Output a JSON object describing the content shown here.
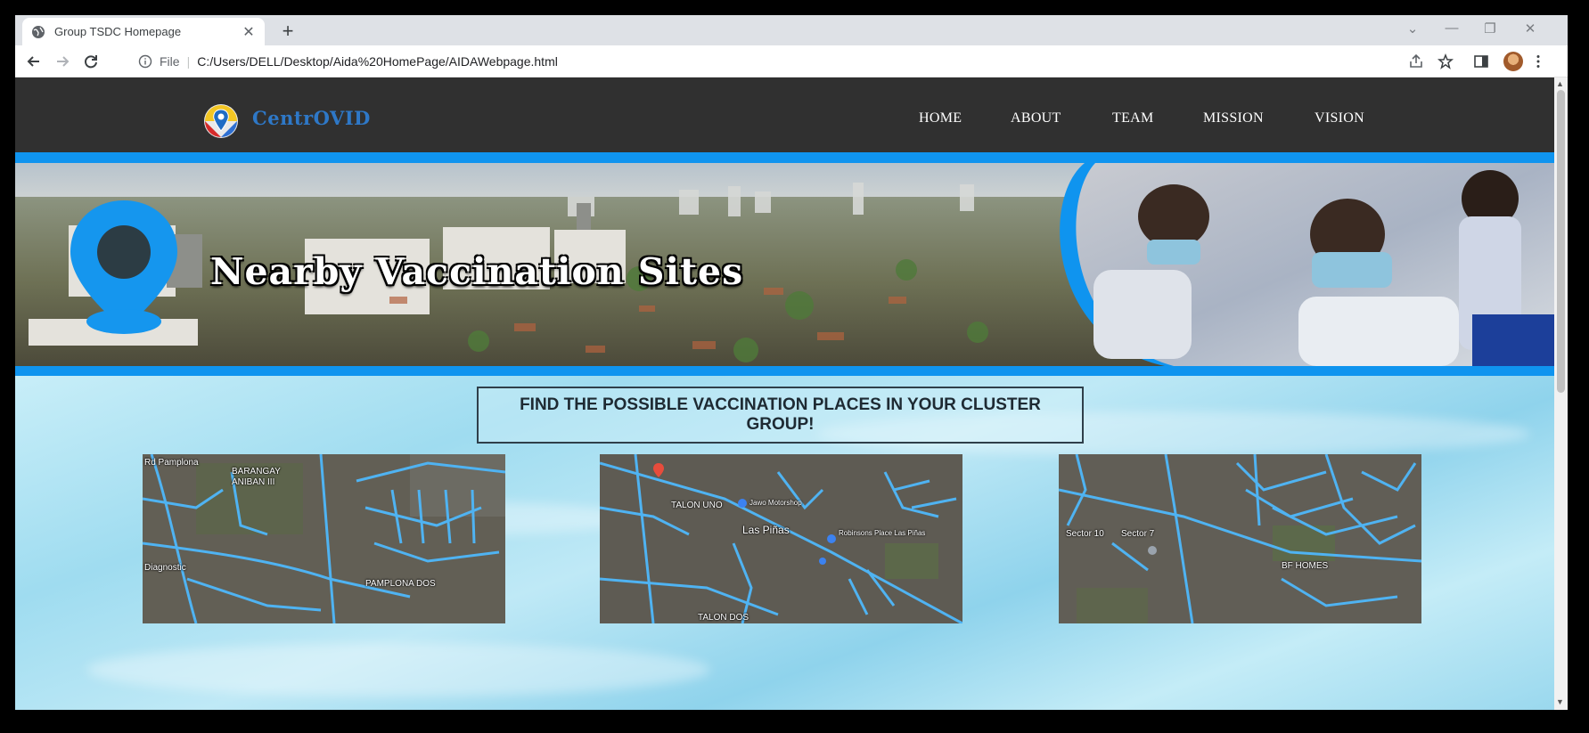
{
  "browser": {
    "tab_title": "Group TSDC Homepage",
    "new_tab_symbol": "+",
    "url_scheme_label": "File",
    "url": "C:/Users/DELL/Desktop/Aida%20HomePage/AIDAWebpage.html"
  },
  "site": {
    "logo_text": "CentrOVID",
    "nav": [
      "HOME",
      "ABOUT",
      "TEAM",
      "MISSION",
      "VISION"
    ],
    "banner_title": "Nearby Vaccination Sites",
    "headline": "FIND THE POSSIBLE VACCINATION PLACES IN YOUR CLUSTER GROUP!",
    "maps": [
      {
        "labels": [
          "BARANGAY",
          "ANIBAN III",
          "PAMPLONA DOS",
          "Diagnostic",
          "Rd Pamplona"
        ]
      },
      {
        "labels": [
          "TALON UNO",
          "Las Piñas",
          "TALON DOS",
          "Jawo Motorshop",
          "Robinsons Place Las Piñas"
        ]
      },
      {
        "labels": [
          "Sector 10",
          "Sector 7",
          "BF HOMES"
        ]
      }
    ]
  },
  "colors": {
    "accent_blue": "#0f94ef",
    "nav_bg": "#303030",
    "logo_blue": "#2e78c7"
  }
}
